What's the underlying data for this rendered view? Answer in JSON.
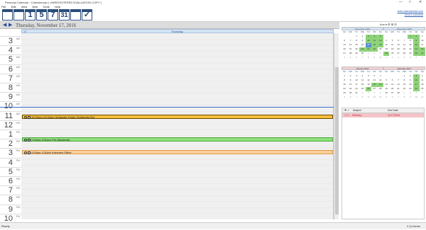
{
  "title": "Personal Calendar - Calendar.epc [ UNREGISTERED EVALUATION COPY ]",
  "window_controls": [
    "—",
    "□",
    "✕"
  ],
  "menu": [
    "File",
    "Edit",
    "View",
    "Item",
    "Tools",
    "Help"
  ],
  "toolbar": {
    "btn1": "1",
    "btn2": "5",
    "btn3": "7",
    "btn4": "31"
  },
  "links": [
    "www.calendarwise.com",
    "Send a comment"
  ],
  "nav": {
    "date": "Thursday, November 17, 2016",
    "prev": "◀",
    "next": "▶",
    "right_label": "Ave ▾  ⚙  ⊞  ⊟"
  },
  "day_header": {
    "left": "17",
    "center": "Thursday"
  },
  "hours": [
    {
      "n": "3",
      "ap": "AM"
    },
    {
      "n": "4",
      "ap": "AM"
    },
    {
      "n": "5",
      "ap": "AM"
    },
    {
      "n": "6",
      "ap": "AM"
    },
    {
      "n": "7",
      "ap": "AM"
    },
    {
      "n": "8",
      "ap": "AM"
    },
    {
      "n": "9",
      "ap": "AM"
    },
    {
      "n": "10",
      "ap": "AM"
    },
    {
      "n": "11",
      "ap": "AM"
    },
    {
      "n": "12",
      "ap": "PM"
    },
    {
      "n": "1",
      "ap": "PM"
    },
    {
      "n": "2",
      "ap": "PM"
    },
    {
      "n": "3",
      "ap": "PM"
    },
    {
      "n": "4",
      "ap": "PM"
    },
    {
      "n": "5",
      "ap": "PM"
    },
    {
      "n": "6",
      "ap": "PM"
    },
    {
      "n": "7",
      "ap": "PM"
    },
    {
      "n": "8",
      "ap": "PM"
    },
    {
      "n": "9",
      "ap": "PM"
    },
    {
      "n": "10",
      "ap": "PM"
    }
  ],
  "appointments": [
    {
      "text": "12:00pm-12:00pm Softpedia Tester (Softpedia.Ro)",
      "bg": "#f6be3c",
      "border": "#6a4a00"
    },
    {
      "text": "2:00pm-3:00pm Pet (Backend)",
      "bg": "#8fe07a",
      "border": "#4ea83d"
    },
    {
      "text": "4:00pm-4:30pm Interview Office",
      "bg": "#f9cf9a",
      "border": "#e09a4a"
    }
  ],
  "mini_cals": [
    {
      "title": "November 2016",
      "days": [
        "SU",
        "MO",
        "TU",
        "WE",
        "TH",
        "FR",
        "SA"
      ],
      "rows": [
        [
          "",
          "",
          "1",
          "2",
          "3",
          "4",
          "5"
        ],
        [
          "6",
          "7",
          "8",
          "9",
          "10",
          "11",
          "12"
        ],
        [
          "13",
          "14",
          "15",
          "16",
          "17",
          "18",
          "19"
        ],
        [
          "20",
          "21",
          "22",
          "23",
          "24",
          "25",
          "26"
        ],
        [
          "27",
          "28",
          "29",
          "30",
          "1",
          "2",
          "3"
        ],
        [
          "4",
          "5",
          "6",
          "7",
          "8",
          "9",
          "10"
        ]
      ]
    },
    {
      "title": "December 2016",
      "days": [
        "SU",
        "MO",
        "TU",
        "WE",
        "TH",
        "FR",
        "SA"
      ],
      "rows": [
        [
          "",
          "",
          "",
          "",
          "1",
          "2",
          "3"
        ],
        [
          "4",
          "5",
          "6",
          "7",
          "8",
          "9",
          "10"
        ],
        [
          "11",
          "12",
          "13",
          "14",
          "15",
          "16",
          "17"
        ],
        [
          "18",
          "19",
          "20",
          "21",
          "22",
          "23",
          "24"
        ],
        [
          "25",
          "26",
          "27",
          "28",
          "29",
          "30",
          "31"
        ],
        [
          "1",
          "2",
          "3",
          "4",
          "5",
          "6",
          "7"
        ]
      ]
    },
    {
      "title": "January 2017",
      "days": [
        "SU",
        "MO",
        "TU",
        "WE",
        "TH",
        "FR",
        "SA"
      ],
      "rows": [
        [
          "1",
          "2",
          "3",
          "4",
          "5",
          "6",
          "7"
        ],
        [
          "8",
          "9",
          "10",
          "11",
          "12",
          "13",
          "14"
        ],
        [
          "15",
          "16",
          "17",
          "18",
          "19",
          "20",
          "21"
        ],
        [
          "22",
          "23",
          "24",
          "25",
          "26",
          "27",
          "28"
        ],
        [
          "29",
          "30",
          "31",
          "1",
          "2",
          "3",
          "4"
        ],
        [
          "5",
          "6",
          "7",
          "8",
          "9",
          "10",
          "11"
        ]
      ]
    },
    {
      "title": "February 2017",
      "days": [
        "SU",
        "MO",
        "TU",
        "WE",
        "TH",
        "FR",
        "SA"
      ],
      "rows": [
        [
          "",
          "",
          "",
          "1",
          "2",
          "3",
          "4"
        ],
        [
          "5",
          "6",
          "7",
          "8",
          "9",
          "10",
          "11"
        ],
        [
          "12",
          "13",
          "14",
          "15",
          "16",
          "17",
          "18"
        ],
        [
          "19",
          "20",
          "21",
          "22",
          "23",
          "24",
          "25"
        ],
        [
          "26",
          "27",
          "28",
          "1",
          "2",
          "3",
          "4"
        ],
        [
          "5",
          "6",
          "7",
          "8",
          "9",
          "10",
          "11"
        ]
      ]
    }
  ],
  "tasks": {
    "col_subject": "Subject",
    "col_due": "Due Date",
    "row_subject": "Birthday",
    "row_due": "11/17/2016"
  },
  "status": {
    "left": "Ready",
    "right": "2 (1) items"
  }
}
